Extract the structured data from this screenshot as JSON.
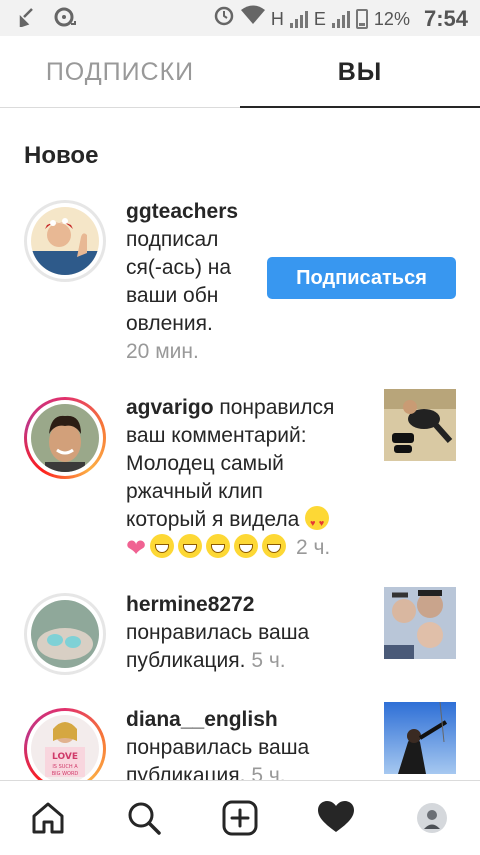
{
  "status_bar": {
    "network_h": "H",
    "network_e": "E",
    "battery": "12%",
    "time": "7:54"
  },
  "tabs": {
    "following": "ПОДПИСКИ",
    "you": "ВЫ"
  },
  "section_title": "Новое",
  "activity": [
    {
      "username": "ggteachers",
      "action_lines": [
        "подписал",
        "ся(-ась) на",
        "ваши обн",
        "овления."
      ],
      "time": "20 мин.",
      "button_label": "Подписаться"
    },
    {
      "username": "agvarigo",
      "action_first": "понравился",
      "action_lines": [
        "ваш комментарий:",
        "Молодец самый",
        "ржачный клип"
      ],
      "action_last": "который я видела",
      "time": "2 ч."
    },
    {
      "username": "hermine8272",
      "action_first": "понравилась ваша",
      "action_last": "публикация.",
      "time": "5 ч."
    },
    {
      "username": "diana__english",
      "action_first": "понравилась ваша",
      "action_last": "публикация.",
      "time": "5 ч.",
      "avatar_text": "LOVE IS SUCH A BIG WORD"
    }
  ],
  "colors": {
    "accent": "#3897f0",
    "story_ring": "#e1306c",
    "muted": "#999999"
  },
  "nav": [
    "home-icon",
    "search-icon",
    "add-post-icon",
    "activity-heart-icon",
    "profile-avatar"
  ]
}
